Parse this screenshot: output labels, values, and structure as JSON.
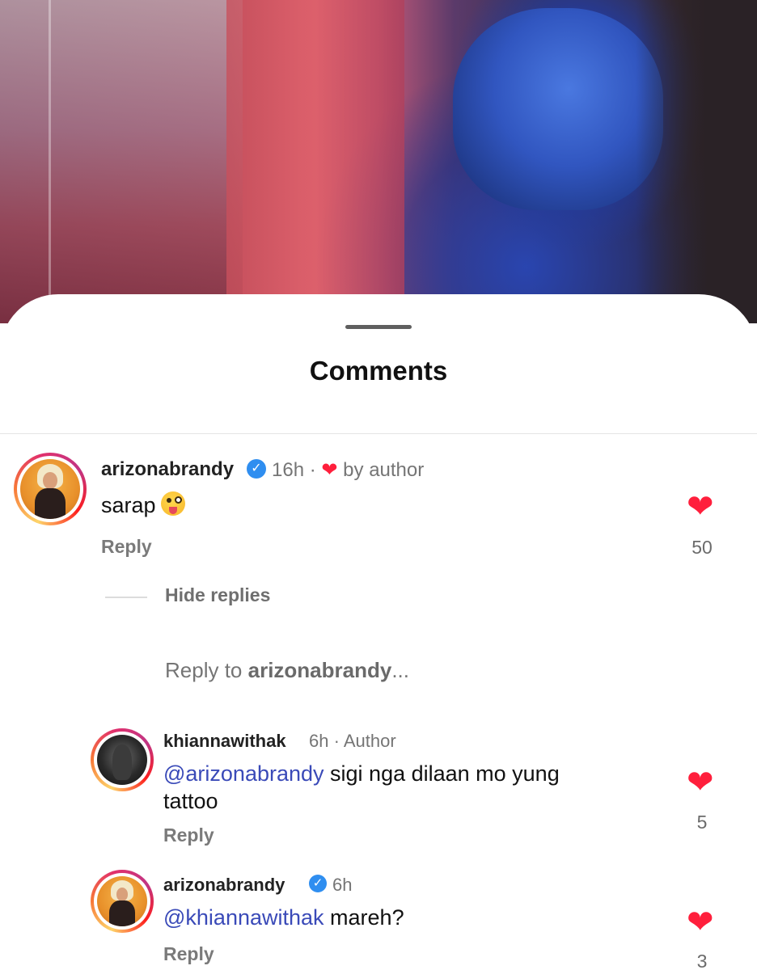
{
  "sheet": {
    "title": "Comments"
  },
  "comments": [
    {
      "username": "arizonabrandy",
      "verified": true,
      "time": "16h",
      "separator": "·",
      "badge": "by author",
      "text": "sarap",
      "reply_label": "Reply",
      "likes": "50"
    }
  ],
  "thread": {
    "hide_replies": "Hide replies",
    "reply_to_prefix": "Reply to ",
    "reply_to_user": "arizonabrandy",
    "reply_to_suffix": "..."
  },
  "replies": [
    {
      "username": "khiannawithak",
      "time": "6h",
      "separator": "·",
      "badge": "Author",
      "mention": "@arizonabrandy",
      "text_line1": " sigi nga dilaan mo yung",
      "text_line2": "tattoo",
      "reply_label": "Reply",
      "likes": "5"
    },
    {
      "username": "arizonabrandy",
      "verified": true,
      "time": "6h",
      "mention": "@khiannawithak",
      "text": " mareh?",
      "reply_label": "Reply",
      "likes": "3"
    }
  ],
  "colors": {
    "like_red": "#ff1f3c",
    "mention_blue": "#3a4ab8",
    "verified_blue": "#2f8ef0"
  }
}
